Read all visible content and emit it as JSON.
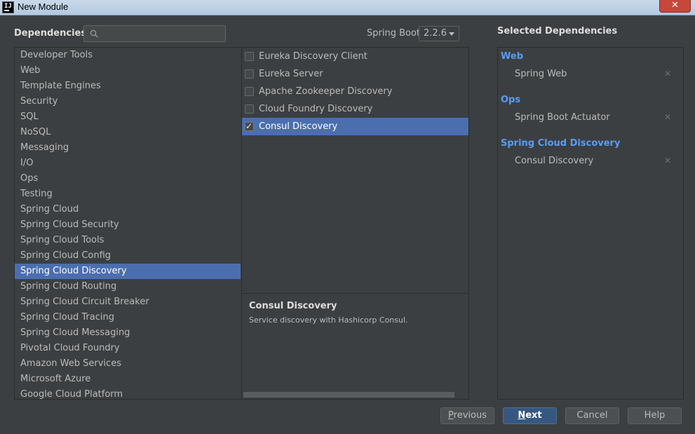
{
  "window": {
    "title": "New Module",
    "close_glyph": "✕",
    "app_icon_text": "IJ"
  },
  "header": {
    "dependencies_label": "Dependencies",
    "search_placeholder": "",
    "spring_boot_label": "Spring Boot",
    "spring_boot_version": "2.2.6",
    "selected_label": "Selected Dependencies"
  },
  "categories": [
    "Developer Tools",
    "Web",
    "Template Engines",
    "Security",
    "SQL",
    "NoSQL",
    "Messaging",
    "I/O",
    "Ops",
    "Testing",
    "Spring Cloud",
    "Spring Cloud Security",
    "Spring Cloud Tools",
    "Spring Cloud Config",
    "Spring Cloud Discovery",
    "Spring Cloud Routing",
    "Spring Cloud Circuit Breaker",
    "Spring Cloud Tracing",
    "Spring Cloud Messaging",
    "Pivotal Cloud Foundry",
    "Amazon Web Services",
    "Microsoft Azure",
    "Google Cloud Platform"
  ],
  "selected_category_index": 14,
  "dependencies": [
    {
      "label": "Eureka Discovery Client",
      "checked": false
    },
    {
      "label": "Eureka Server",
      "checked": false
    },
    {
      "label": "Apache Zookeeper Discovery",
      "checked": false
    },
    {
      "label": "Cloud Foundry Discovery",
      "checked": false
    },
    {
      "label": "Consul Discovery",
      "checked": true
    }
  ],
  "description": {
    "title": "Consul Discovery",
    "text": "Service discovery with Hashicorp Consul."
  },
  "selected_groups": [
    {
      "group": "Web",
      "items": [
        "Spring Web"
      ]
    },
    {
      "group": "Ops",
      "items": [
        "Spring Boot Actuator"
      ]
    },
    {
      "group": "Spring Cloud Discovery",
      "items": [
        "Consul Discovery"
      ]
    }
  ],
  "remove_glyph": "✕",
  "buttons": {
    "previous": {
      "mnemonic": "P",
      "rest": "revious"
    },
    "next": {
      "mnemonic": "N",
      "rest": "ext"
    },
    "cancel": "Cancel",
    "help": "Help"
  },
  "colors": {
    "accent": "#4b6eaf",
    "group_title": "#589df6",
    "background": "#3c3f41"
  }
}
